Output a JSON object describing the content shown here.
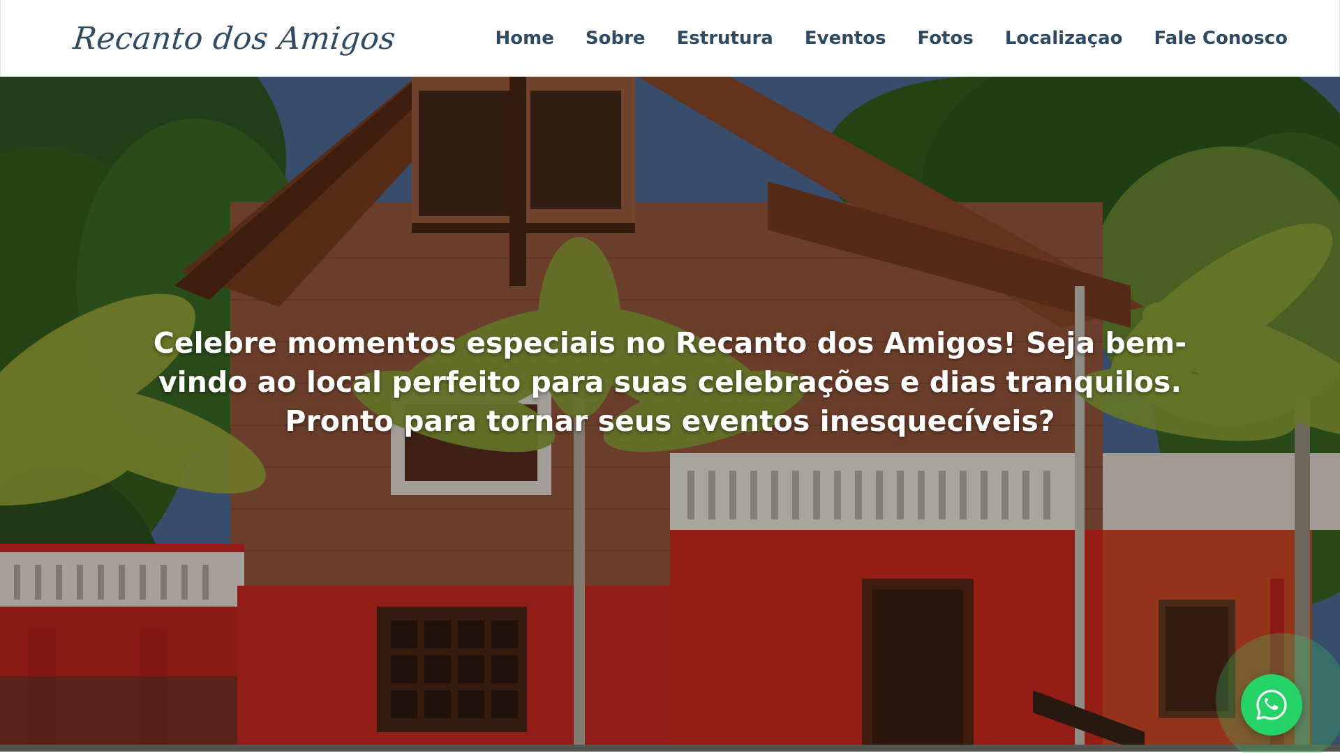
{
  "header": {
    "logo_text": "Recanto dos Amigos",
    "nav": [
      {
        "label": "Home"
      },
      {
        "label": "Sobre"
      },
      {
        "label": "Estrutura"
      },
      {
        "label": "Eventos"
      },
      {
        "label": "Fotos"
      },
      {
        "label": "Localizaçao"
      },
      {
        "label": "Fale Conosco"
      }
    ]
  },
  "hero": {
    "line1": "Celebre momentos especiais no Recanto dos Amigos! Seja bem-",
    "line2": "vindo ao local perfeito para suas celebrações e dias tranquilos.",
    "line3": "Pronto para tornar seus eventos inesquecíveis?",
    "background_image": "photo of a brick chalet house with red lower walls, white balustrades, palm trees and dense green trees under a blue sky"
  },
  "whatsapp": {
    "icon": "whatsapp-icon",
    "color": "#25d366"
  },
  "colors": {
    "nav_text": "#2f4a63",
    "hero_text": "#ffffff",
    "red_wall": "#d4281f",
    "brick": "#9b5a3c",
    "roof": "#8e4a2b"
  }
}
